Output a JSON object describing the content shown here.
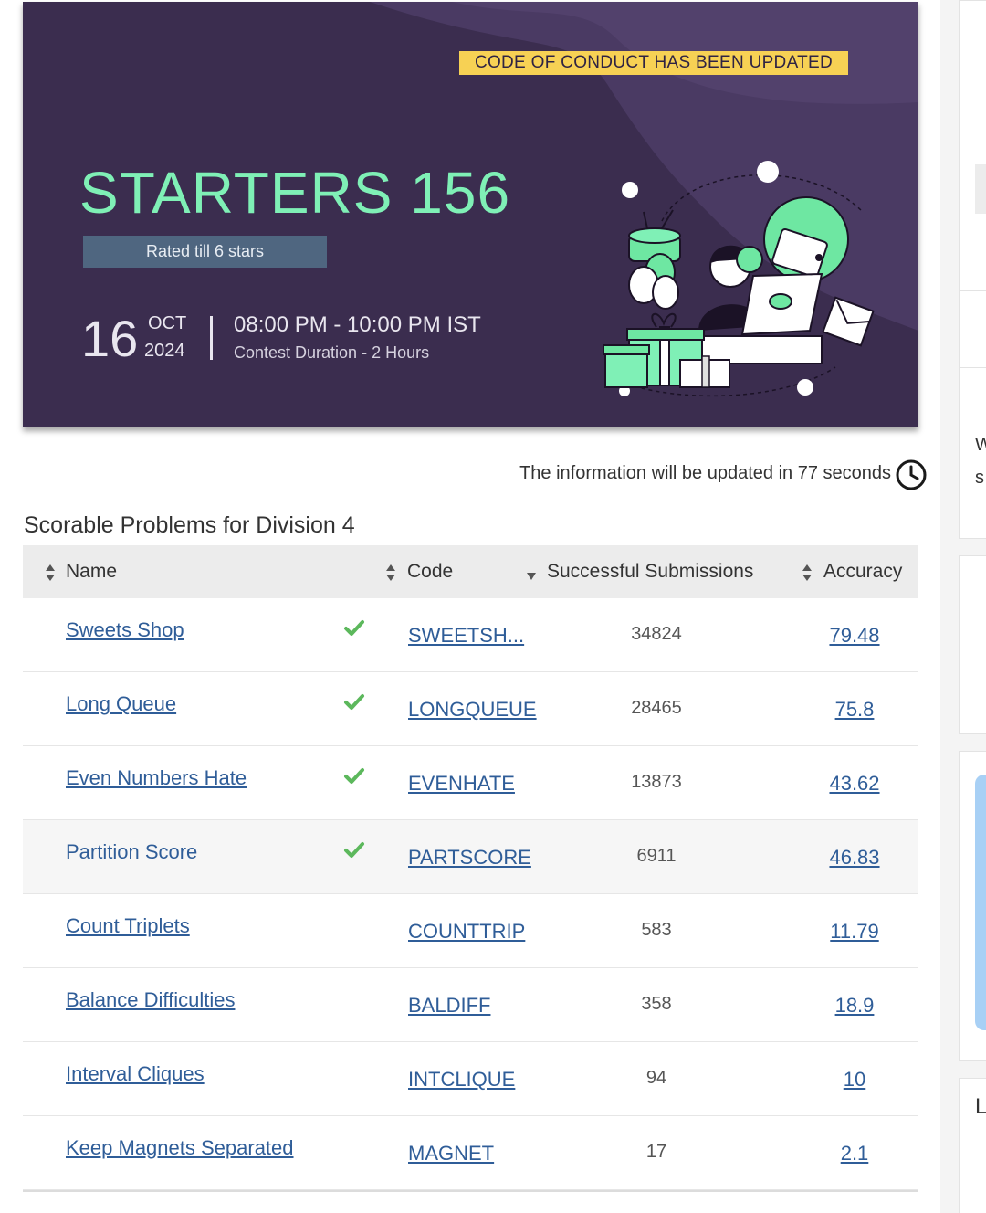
{
  "banner": {
    "notice": "CODE OF CONDUCT HAS BEEN UPDATED",
    "title": "STARTERS 156",
    "rated": "Rated till 6 stars",
    "day": "16",
    "month": "OCT",
    "year": "2024",
    "time": "08:00 PM - 10:00 PM IST",
    "duration": "Contest Duration - 2 Hours"
  },
  "update_text": "The information will be updated in 77 seconds",
  "section_title": "Scorable Problems for Division 4",
  "table": {
    "headers": {
      "name": "Name",
      "code": "Code",
      "submissions": "Successful Submissions",
      "accuracy": "Accuracy"
    },
    "rows": [
      {
        "name": "Sweets Shop",
        "solved": true,
        "code": "SWEETSH...",
        "submissions": "34824",
        "accuracy": "79.48"
      },
      {
        "name": "Long Queue",
        "solved": true,
        "code": "LONGQUEUE",
        "submissions": "28465",
        "accuracy": "75.8"
      },
      {
        "name": "Even Numbers Hate",
        "solved": true,
        "code": "EVENHATE",
        "submissions": "13873",
        "accuracy": "43.62"
      },
      {
        "name": "Partition Score",
        "solved": true,
        "code": "PARTSCORE",
        "submissions": "6911",
        "accuracy": "46.83"
      },
      {
        "name": "Count Triplets",
        "solved": false,
        "code": "COUNTTRIP",
        "submissions": "583",
        "accuracy": "11.79"
      },
      {
        "name": "Balance Difficulties",
        "solved": false,
        "code": "BALDIFF",
        "submissions": "358",
        "accuracy": "18.9"
      },
      {
        "name": "Interval Cliques",
        "solved": false,
        "code": "INTCLIQUE",
        "submissions": "94",
        "accuracy": "10"
      },
      {
        "name": "Keep Magnets Separated",
        "solved": false,
        "code": "MAGNET",
        "submissions": "17",
        "accuracy": "2.1"
      }
    ]
  },
  "sidebar": {
    "partial_text_1": "W",
    "partial_text_2": "s",
    "partial_text_3": "L"
  },
  "colors": {
    "banner_bg": "#3b2d4f",
    "title": "#7ff0b6",
    "notice_bg": "#f7d154",
    "link": "#2f5d98",
    "check": "#5cb85c"
  }
}
